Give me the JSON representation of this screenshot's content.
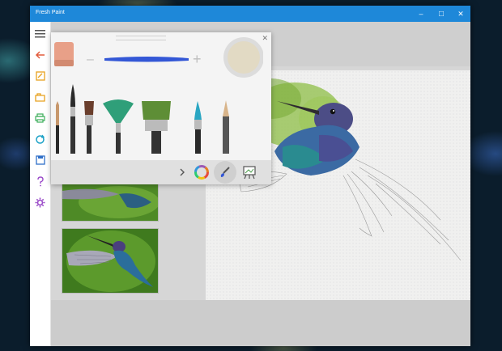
{
  "window": {
    "title": "Fresh Paint",
    "controls": {
      "minimize": "–",
      "maximize": "□",
      "close": "✕"
    }
  },
  "sidebar": {
    "items": [
      {
        "icon": "hamburger-menu-icon"
      },
      {
        "icon": "back-arrow-icon",
        "color": "#e25b3c"
      },
      {
        "icon": "new-canvas-icon",
        "color": "#e8a11e"
      },
      {
        "icon": "open-folder-icon",
        "color": "#e8a11e"
      },
      {
        "icon": "print-icon",
        "color": "#3cae5a"
      },
      {
        "icon": "share-icon",
        "color": "#1ba1c6"
      },
      {
        "icon": "save-icon",
        "color": "#2f6fc8"
      },
      {
        "icon": "help-icon",
        "color": "#9b4cc9"
      },
      {
        "icon": "settings-gear-icon",
        "color": "#9b4cc9"
      }
    ]
  },
  "brush_panel": {
    "close_label": "✕",
    "size_minus": "–",
    "size_plus": "+",
    "brushes": [
      "watercolor-thin-brush",
      "pointed-round-brush",
      "flat-brush",
      "fan-brush",
      "wide-flat-brush",
      "fine-liner-brush",
      "pencil-tool"
    ],
    "tools": [
      "collapse-arrow",
      "color-wheel",
      "brush-tool",
      "canvas-easel"
    ],
    "colors": {
      "stroke": "#3357d6",
      "swatch": "#e2dac4",
      "selected_tool_bg": "#cfcfcf"
    }
  },
  "thumbnails": [
    {
      "name": "hummingbird-reference-top"
    },
    {
      "name": "hummingbird-reference-bottom"
    }
  ]
}
